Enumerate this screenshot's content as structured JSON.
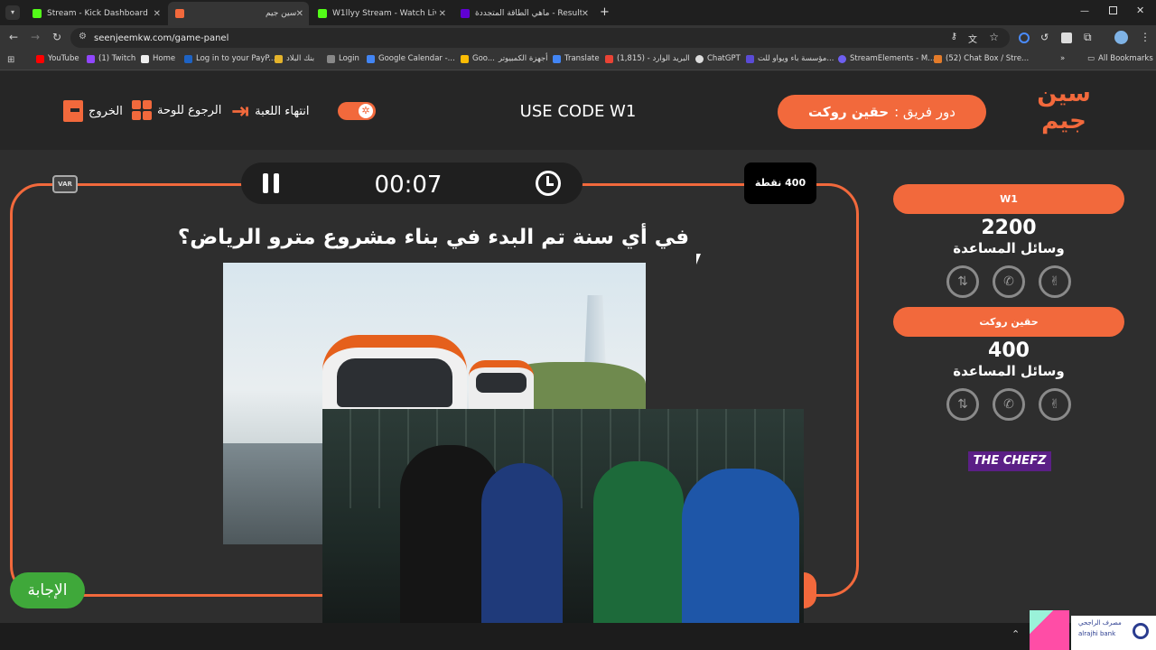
{
  "browser": {
    "tabs": [
      {
        "title": "Stream - Kick Dashboard",
        "color": "#53fc18"
      },
      {
        "title": "سين جيم",
        "color": "#f2693c"
      },
      {
        "title": "W1llyy Stream - Watch Live on",
        "color": "#53fc18"
      },
      {
        "title": "ماهي الطاقة المتجددة - Results",
        "color": "#6001d2"
      }
    ],
    "url": "seenjeemkw.com/game-panel",
    "bookmarks": [
      "YouTube",
      "(1) Twitch",
      "Home",
      "Log in to your PayP...",
      "بنك البلاد",
      "Login",
      "Google Calendar -...",
      "Goo...",
      "أجهزة الكمبيوتر",
      "Translate",
      "(1,815) - البريد الوارد",
      "ChatGPT",
      "مؤسسة باء ويواو للت...",
      "StreamElements - M...",
      "(52) Chat Box / Stre..."
    ],
    "all_bookmarks": "All Bookmarks"
  },
  "header": {
    "logo_text": "سين جيم",
    "team_turn_label": "دور فريق :",
    "team_turn_name": "حقين روكت",
    "promo": "USE CODE W1",
    "end_game": "انتهاء اللعبة",
    "back_to_board": "الرجوع للوحة",
    "exit": "الخروج"
  },
  "question": {
    "timer": "00:07",
    "points": "400 نقطة",
    "var_label": "VAR",
    "text": "في أي سنة تم البدء في بناء مشروع مترو الرياض؟",
    "answer_button": "الإجابة"
  },
  "teams": [
    {
      "name": "W1",
      "score": "2200",
      "aids_label": "وسائل المساعدة"
    },
    {
      "name": "حقين روكت",
      "score": "400",
      "aids_label": "وسائل المساعدة"
    }
  ],
  "sponsor": "THE CHEFZ",
  "bank": {
    "name_ar": "مصرف الراجحي",
    "name_en": "alrajhi bank"
  },
  "colors": {
    "accent": "#f2693c",
    "answer_green": "#3fa83a",
    "bg": "#2e2e2e"
  }
}
